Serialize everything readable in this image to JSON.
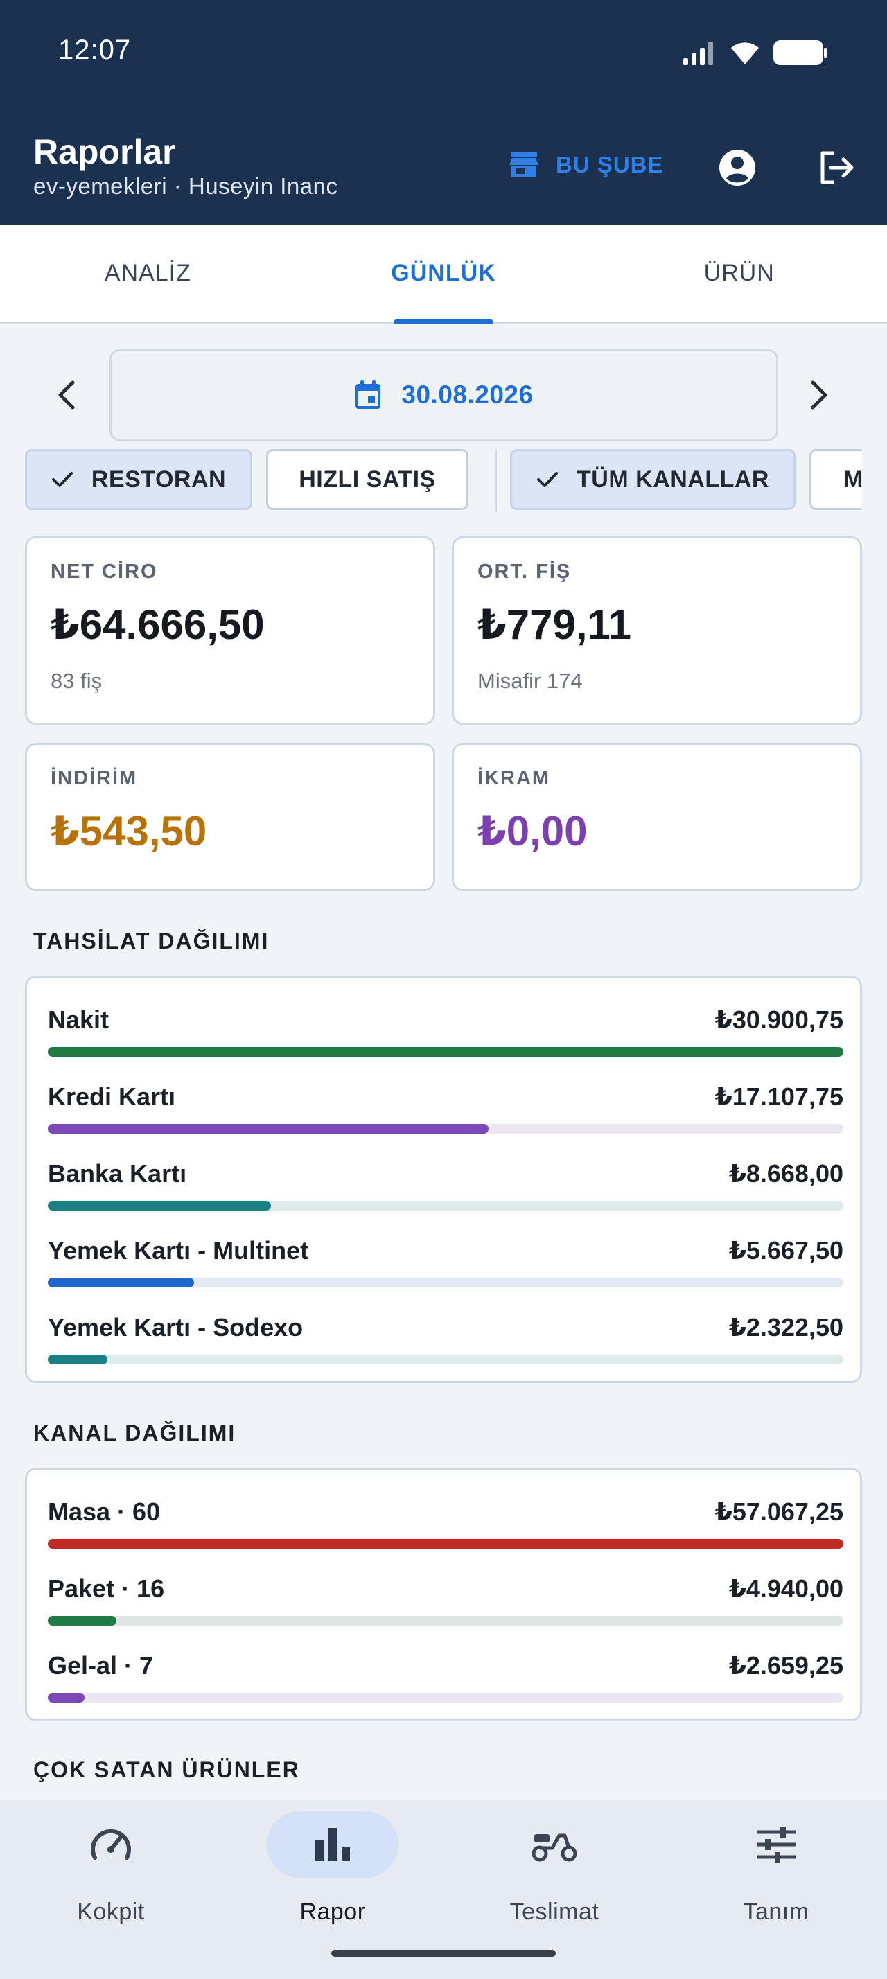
{
  "status_bar": {
    "time": "12:07"
  },
  "header": {
    "title": "Raporlar",
    "subtitle": "ev-yemekleri · Huseyin Inanc",
    "branch_label": "BU ŞUBE"
  },
  "tabs": [
    {
      "label": "ANALİZ",
      "active": false
    },
    {
      "label": "GÜNLÜK",
      "active": true
    },
    {
      "label": "ÜRÜN",
      "active": false
    }
  ],
  "date": "30.08.2026",
  "filters": {
    "restoran": "RESTORAN",
    "hizli_satis": "HIZLI SATIŞ",
    "tum_kanallar": "TÜM KANALLAR",
    "partial": "M"
  },
  "kpis": {
    "net_ciro": {
      "label": "NET CİRO",
      "value": "₺64.666,50",
      "sub": "83 fiş"
    },
    "ort_fis": {
      "label": "ORT. FİŞ",
      "value": "₺779,11",
      "sub": "Misafir 174"
    },
    "indirim": {
      "label": "İNDİRİM",
      "value": "₺543,50",
      "color": "#b8720a"
    },
    "ikram": {
      "label": "İKRAM",
      "value": "₺0,00",
      "color": "#7e3fb0"
    }
  },
  "payments": {
    "title": "TAHSİLAT DAĞILIMI",
    "items": [
      {
        "label": "Nakit",
        "value": "₺30.900,75",
        "ratio": 1.0,
        "color": "#1f7a45",
        "track": "#dde8e2"
      },
      {
        "label": "Kredi Kartı",
        "value": "₺17.107,75",
        "ratio": 0.5536,
        "color": "#7d48b8",
        "track": "#ece6f3"
      },
      {
        "label": "Banka Kartı",
        "value": "₺8.668,00",
        "ratio": 0.2805,
        "color": "#1b8084",
        "track": "#dfeaeb"
      },
      {
        "label": "Yemek Kartı - Multinet",
        "value": "₺5.667,50",
        "ratio": 0.1834,
        "color": "#1f67c9",
        "track": "#e2e9f5"
      },
      {
        "label": "Yemek Kartı - Sodexo",
        "value": "₺2.322,50",
        "ratio": 0.0752,
        "color": "#1b8084",
        "track": "#dfeaeb"
      }
    ]
  },
  "channels": {
    "title": "KANAL DAĞILIMI",
    "items": [
      {
        "label": "Masa · 60",
        "value": "₺57.067,25",
        "ratio": 1.0,
        "color": "#bf2a22",
        "track": "#f2e2e1"
      },
      {
        "label": "Paket · 16",
        "value": "₺4.940,00",
        "ratio": 0.0866,
        "color": "#1f7a45",
        "track": "#dde8e2"
      },
      {
        "label": "Gel-al · 7",
        "value": "₺2.659,25",
        "ratio": 0.0466,
        "color": "#7d48b8",
        "track": "#ece6f3"
      }
    ]
  },
  "top_products_title": "ÇOK SATAN ÜRÜNLER",
  "bottom_nav": [
    {
      "label": "Kokpit",
      "icon": "speedometer-icon",
      "active": false
    },
    {
      "label": "Rapor",
      "icon": "bar-chart-icon",
      "active": true
    },
    {
      "label": "Teslimat",
      "icon": "scooter-icon",
      "active": false
    },
    {
      "label": "Tanım",
      "icon": "sliders-icon",
      "active": false
    }
  ]
}
